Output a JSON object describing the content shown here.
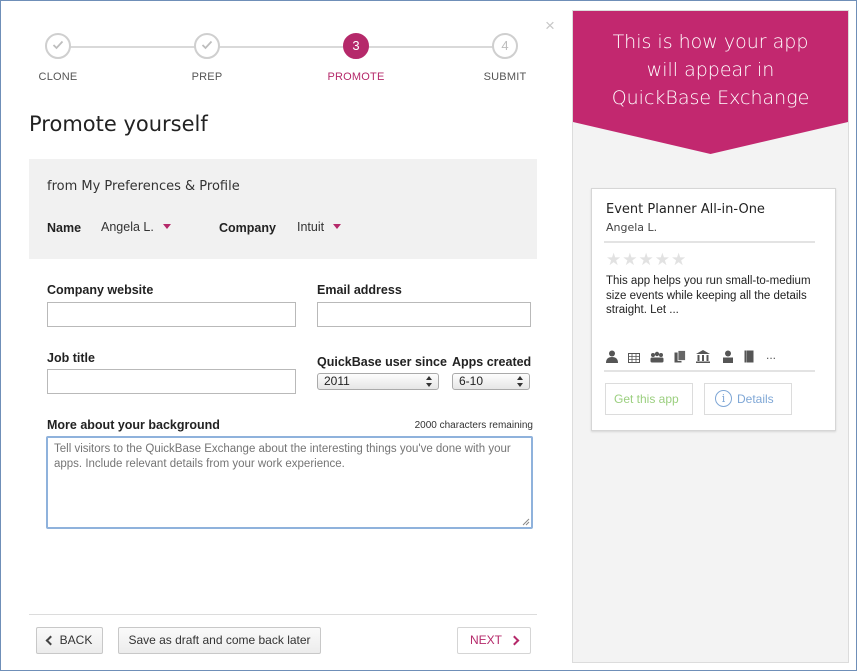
{
  "close_icon": "×",
  "steps": [
    {
      "number": "",
      "label": "CLONE",
      "state": "done"
    },
    {
      "number": "",
      "label": "PREP",
      "state": "done"
    },
    {
      "number": "3",
      "label": "PROMOTE",
      "state": "active"
    },
    {
      "number": "4",
      "label": "SUBMIT",
      "state": "pending"
    }
  ],
  "page_title": "Promote yourself",
  "preferences": {
    "heading": "from My Preferences & Profile",
    "name_label": "Name",
    "name_value": "Angela L.",
    "company_label": "Company",
    "company_value": "Intuit"
  },
  "form": {
    "company_website_label": "Company website",
    "company_website_value": "",
    "email_label": "Email address",
    "email_value": "",
    "job_title_label": "Job title",
    "job_title_value": "",
    "user_since_label": "QuickBase user since",
    "user_since_value": "2011",
    "apps_created_label": "Apps created",
    "apps_created_value": "6-10",
    "background_label": "More about your background",
    "chars_remaining": "2000 characters remaining",
    "background_placeholder": "Tell visitors to the QuickBase Exchange about the interesting things you've done with your apps. Include relevant details from your work experience."
  },
  "footer": {
    "back_label": "BACK",
    "draft_label": "Save as draft and come back later",
    "next_label": "NEXT"
  },
  "preview": {
    "banner_line1": "This is how your app",
    "banner_line2": "will appear in",
    "banner_line3": "QuickBase Exchange",
    "app_title": "Event Planner All-in-One",
    "app_author": "Angela L.",
    "stars": "★★★★★",
    "rating": 0,
    "description": "This app helps you run small-to-medium size events while keeping all the details straight. Let ...",
    "feature_icons": [
      "person-icon",
      "table-icon",
      "group-icon",
      "documents-icon",
      "building-icon",
      "person-badge-icon",
      "book-icon"
    ],
    "more_icons": "...",
    "get_app_label": "Get this app",
    "details_label": "Details",
    "info_icon": "i"
  },
  "colors": {
    "accent": "#b5296a",
    "banner": "#c2286f",
    "get_app_text": "#9bcf7f",
    "details_text": "#7fa7d6",
    "focus_border": "#8fb2dc"
  }
}
